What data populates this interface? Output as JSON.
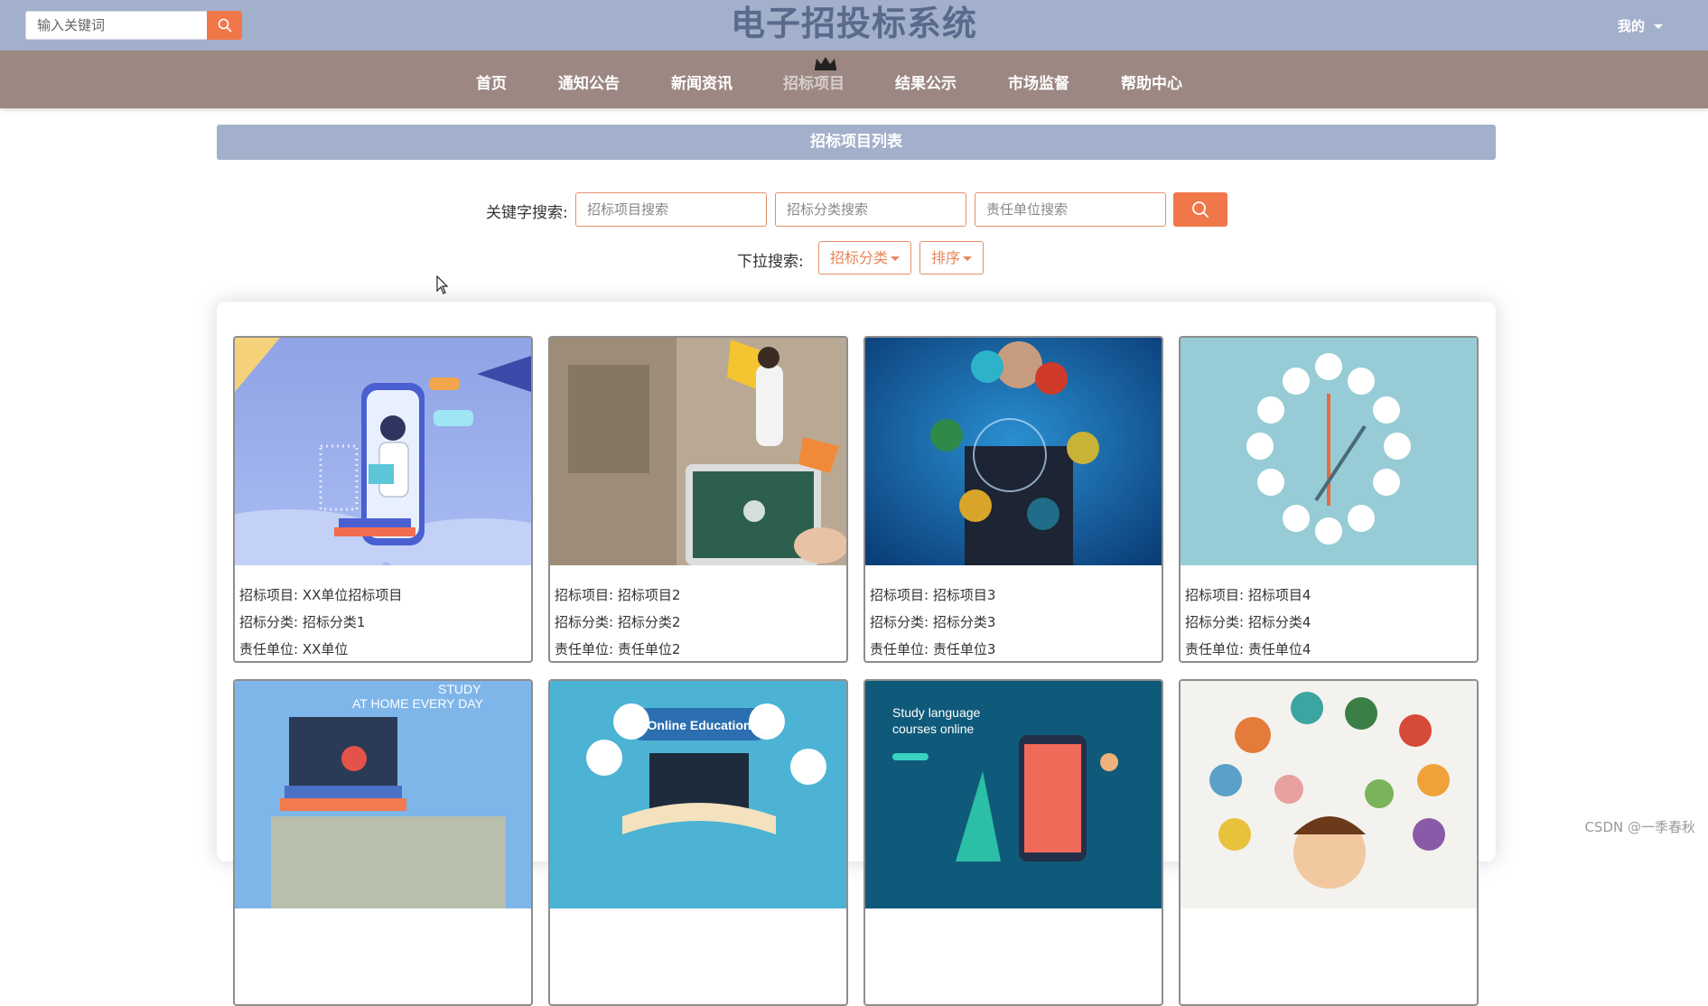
{
  "header": {
    "search_placeholder": "输入关键词",
    "site_title": "电子招投标系统",
    "user_menu": "我的"
  },
  "nav": {
    "items": [
      {
        "label": "首页"
      },
      {
        "label": "通知公告"
      },
      {
        "label": "新闻资讯"
      },
      {
        "label": "招标项目",
        "active": true
      },
      {
        "label": "结果公示"
      },
      {
        "label": "市场监督"
      },
      {
        "label": "帮助中心"
      }
    ]
  },
  "section": {
    "title": "招标项目列表"
  },
  "filters": {
    "keyword_label": "关键字搜索:",
    "project_placeholder": "招标项目搜索",
    "category_placeholder": "招标分类搜索",
    "unit_placeholder": "责任单位搜索",
    "dropdown_label": "下拉搜索:",
    "category_dropdown": "招标分类",
    "sort_dropdown": "排序"
  },
  "cards": [
    {
      "project": "招标项目: XX单位招标项目",
      "category": "招标分类: 招标分类1",
      "unit": "责任单位: XX单位"
    },
    {
      "project": "招标项目: 招标项目2",
      "category": "招标分类: 招标分类2",
      "unit": "责任单位: 责任单位2"
    },
    {
      "project": "招标项目: 招标项目3",
      "category": "招标分类: 招标分类3",
      "unit": "责任单位: 责任单位3"
    },
    {
      "project": "招标项目: 招标项目4",
      "category": "招标分类: 招标分类4",
      "unit": "责任单位: 责任单位4"
    }
  ],
  "row2_images": {
    "study": "STUDY",
    "at_home": "AT HOME EVERY DAY",
    "online_education": "Online Education",
    "study_language_1": "Study language",
    "study_language_2": "courses online"
  },
  "colors": {
    "accent": "#f0774a",
    "topbar": "#a3b0cb",
    "nav": "#9c8782"
  },
  "watermark": "CSDN @一季春秋"
}
